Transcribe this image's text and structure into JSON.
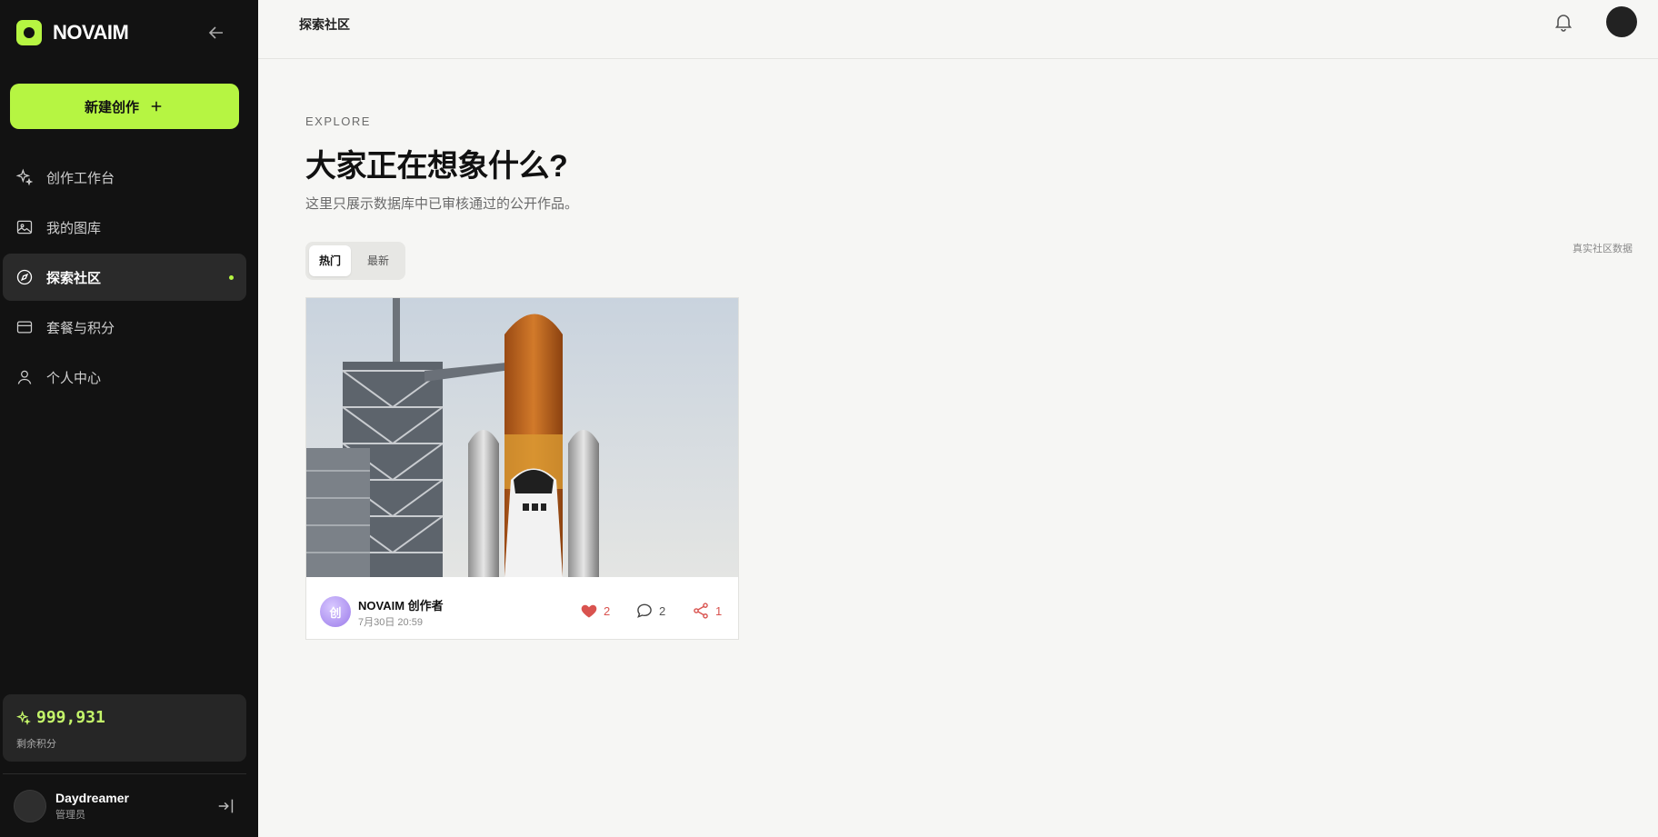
{
  "brand": {
    "name": "NOVAIM",
    "accent": "#b6f542"
  },
  "sidebar": {
    "new_button": "新建创作",
    "items": [
      {
        "label": "创作工作台",
        "icon": "sparkle-icon"
      },
      {
        "label": "我的图库",
        "icon": "image-icon"
      },
      {
        "label": "探索社区",
        "icon": "compass-icon",
        "active": true
      },
      {
        "label": "套餐与积分",
        "icon": "card-icon"
      },
      {
        "label": "个人中心",
        "icon": "user-icon"
      }
    ],
    "credits": {
      "value": "999,931",
      "label": "剩余积分"
    },
    "user": {
      "name": "Daydreamer",
      "role": "管理员"
    }
  },
  "topbar": {
    "title": "探索社区"
  },
  "main": {
    "eyebrow": "EXPLORE",
    "headline": "大家正在想象什么?",
    "subtitle": "这里只展示数据库中已审核通过的公开作品。",
    "tabs": [
      "热门",
      "最新"
    ],
    "data_note": "真实社区数据"
  },
  "posts": [
    {
      "author": "NOVAIM 创作者",
      "avatar_char": "创",
      "time": "7月30日 20:59",
      "likes": "2",
      "comments": "2",
      "shares": "1",
      "like_color": "#d9534f"
    }
  ]
}
